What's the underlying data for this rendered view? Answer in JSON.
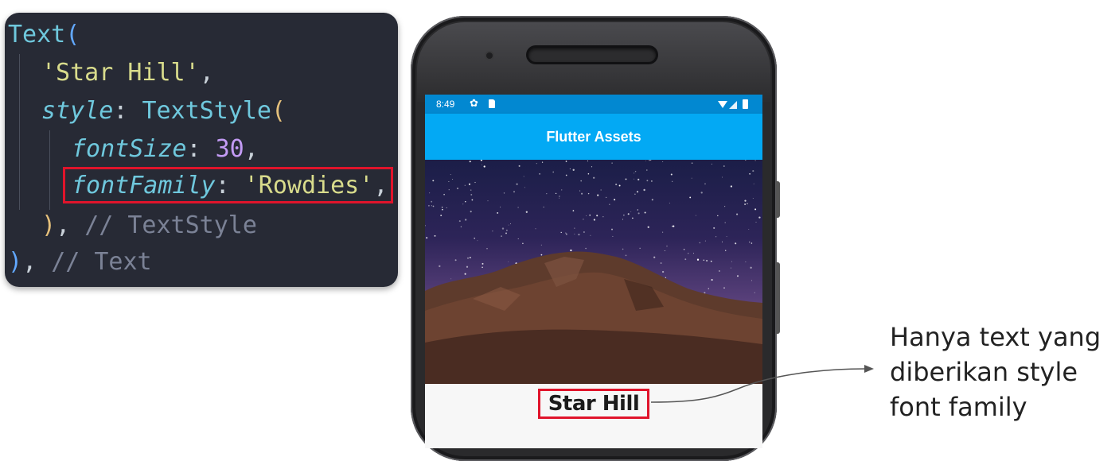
{
  "code": {
    "lines": [
      {
        "parts": [
          {
            "t": "Text",
            "c": "tk-class"
          },
          {
            "t": "(",
            "c": "tk-paren2"
          }
        ],
        "indent": 0
      },
      {
        "parts": [
          {
            "t": "'Star Hill'",
            "c": "tk-str"
          },
          {
            "t": ",",
            "c": "tk-punct"
          }
        ],
        "indent": 1
      },
      {
        "parts": [
          {
            "t": "style",
            "c": "tk-prop"
          },
          {
            "t": ": ",
            "c": "tk-punct"
          },
          {
            "t": "TextStyle",
            "c": "tk-class"
          },
          {
            "t": "(",
            "c": "tk-paren"
          }
        ],
        "indent": 1
      },
      {
        "parts": [
          {
            "t": "fontSize",
            "c": "tk-prop"
          },
          {
            "t": ": ",
            "c": "tk-punct"
          },
          {
            "t": "30",
            "c": "tk-num"
          },
          {
            "t": ",",
            "c": "tk-punct"
          }
        ],
        "indent": 2
      },
      {
        "parts": [
          {
            "t": "fontFamily",
            "c": "tk-prop"
          },
          {
            "t": ": ",
            "c": "tk-punct"
          },
          {
            "t": "'Rowdies'",
            "c": "tk-str"
          },
          {
            "t": ",",
            "c": "tk-punct"
          }
        ],
        "indent": 2
      },
      {
        "parts": [
          {
            "t": ")",
            "c": "tk-paren"
          },
          {
            "t": ", ",
            "c": "tk-punct"
          },
          {
            "t": "// TextStyle",
            "c": "tk-comment"
          }
        ],
        "indent": 1
      },
      {
        "parts": [
          {
            "t": ")",
            "c": "tk-paren2"
          },
          {
            "t": ", ",
            "c": "tk-punct"
          },
          {
            "t": "// Text",
            "c": "tk-comment"
          }
        ],
        "indent": 0
      }
    ]
  },
  "phone": {
    "status": {
      "time": "8:49"
    },
    "app_bar_title": "Flutter Assets",
    "content_text": "Star Hill"
  },
  "annotation": {
    "lines": [
      "Hanya text yang",
      "diberikan style",
      "font family"
    ]
  },
  "colors": {
    "highlight": "#e0142b",
    "app_bar": "#03a9f4",
    "status_bar": "#0288d1",
    "code_bg": "#272a35"
  }
}
